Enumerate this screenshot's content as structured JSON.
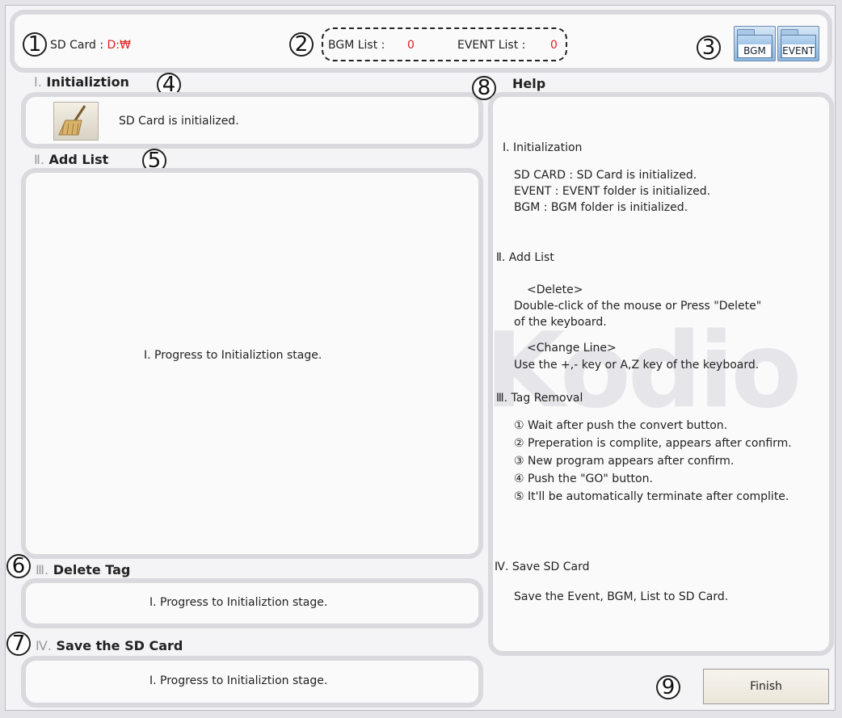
{
  "sd_card": {
    "label": "SD Card :",
    "value": "D:₩"
  },
  "lists": {
    "bgm_label": "BGM List :",
    "bgm_count": "0",
    "event_label": "EVENT List :",
    "event_count": "0"
  },
  "folders": {
    "bgm": "BGM",
    "event": "EVENT"
  },
  "markers": [
    "1",
    "2",
    "3",
    "4",
    "5",
    "6",
    "7",
    "8",
    "9"
  ],
  "sections": {
    "init": {
      "roman": "Ⅰ.",
      "title": "Initializtion",
      "status": "SD Card is initialized."
    },
    "add_list": {
      "roman": "Ⅱ.",
      "title": "Add List",
      "status": "Ⅰ. Progress to Initializtion stage."
    },
    "delete_tag": {
      "roman": "Ⅲ.",
      "title": "Delete Tag",
      "status": "Ⅰ. Progress to Initializtion stage."
    },
    "save_sd": {
      "roman": "Ⅳ.",
      "title": "Save the SD Card",
      "status": "Ⅰ. Progress to Initializtion stage."
    }
  },
  "help": {
    "title": "Help",
    "watermark": "Kodio",
    "s1_title": "Ⅰ. Initialization",
    "s1_lines": [
      "SD CARD : SD Card is initialized.",
      "EVENT : EVENT folder is initialized.",
      "BGM : BGM folder is initialized."
    ],
    "s2_title": "Ⅱ. Add List",
    "s2_delete_head": "<Delete>",
    "s2_delete_lines": [
      "Double-click of the mouse or Press \"Delete\"",
      "of the keyboard."
    ],
    "s2_change_head": "<Change Line>",
    "s2_change_line": "Use the +,- key or A,Z key of the keyboard.",
    "s3_title": "Ⅲ. Tag Removal",
    "s3_lines": [
      "① Wait after push the convert button.",
      "② Preperation is complite, appears after confirm.",
      "③ New program appears after confirm.",
      "④ Push the \"GO\" button.",
      "⑤ It'll be automatically terminate after complite."
    ],
    "s4_title": "Ⅳ. Save SD Card",
    "s4_line": "Save the Event, BGM, List to SD Card."
  },
  "finish_label": "Finish"
}
